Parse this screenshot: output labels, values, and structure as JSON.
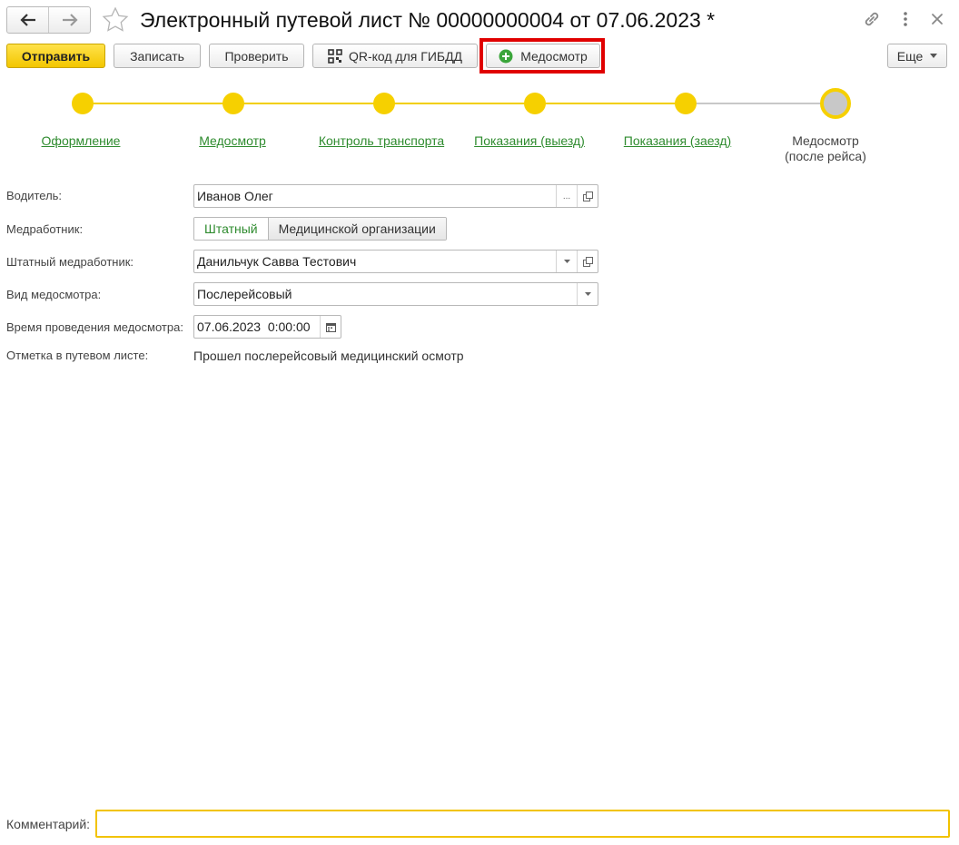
{
  "window": {
    "title": "Электронный путевой лист № 00000000004 от 07.06.2023 *",
    "icons": [
      "back-arrow-icon",
      "forward-arrow-icon",
      "star-icon",
      "link-icon",
      "more-vertical-icon",
      "close-icon"
    ]
  },
  "toolbar": {
    "send_label": "Отправить",
    "save_label": "Записать",
    "check_label": "Проверить",
    "qr_label": "QR-код для ГИБДД",
    "medcheck_label": "Медосмотр",
    "more_label": "Еще"
  },
  "steps": [
    {
      "label": "Оформление",
      "status": "done"
    },
    {
      "label": "Медосмотр",
      "status": "done"
    },
    {
      "label": "Контроль транспорта",
      "status": "done"
    },
    {
      "label": "Показания (выезд)",
      "status": "done"
    },
    {
      "label": "Показания (заезд)",
      "status": "done"
    },
    {
      "label_line1": "Медосмотр",
      "label_line2": "(после рейса)",
      "status": "current"
    }
  ],
  "form": {
    "driver": {
      "label": "Водитель:",
      "value": "Иванов Олег"
    },
    "medworker": {
      "label": "Медработник:",
      "options": [
        "Штатный",
        "Медицинской организации"
      ],
      "selected": "Штатный"
    },
    "staff_medworker": {
      "label": "Штатный медработник:",
      "value": "Данильчук Савва Тестович"
    },
    "exam_type": {
      "label": "Вид медосмотра:",
      "value": "Послерейсовый"
    },
    "exam_time": {
      "label": "Время проведения медосмотра:",
      "value": "07.06.2023  0:00:00"
    },
    "waybill_mark": {
      "label": "Отметка в путевом листе:",
      "value": "Прошел послерейсовый медицинский осмотр"
    }
  },
  "comment": {
    "label": "Комментарий:",
    "value": ""
  },
  "colors": {
    "accent_yellow": "#F6D000",
    "link_green": "#2E8B2E",
    "highlight_red": "#E00000",
    "pending_grey": "#C8C8C8"
  }
}
